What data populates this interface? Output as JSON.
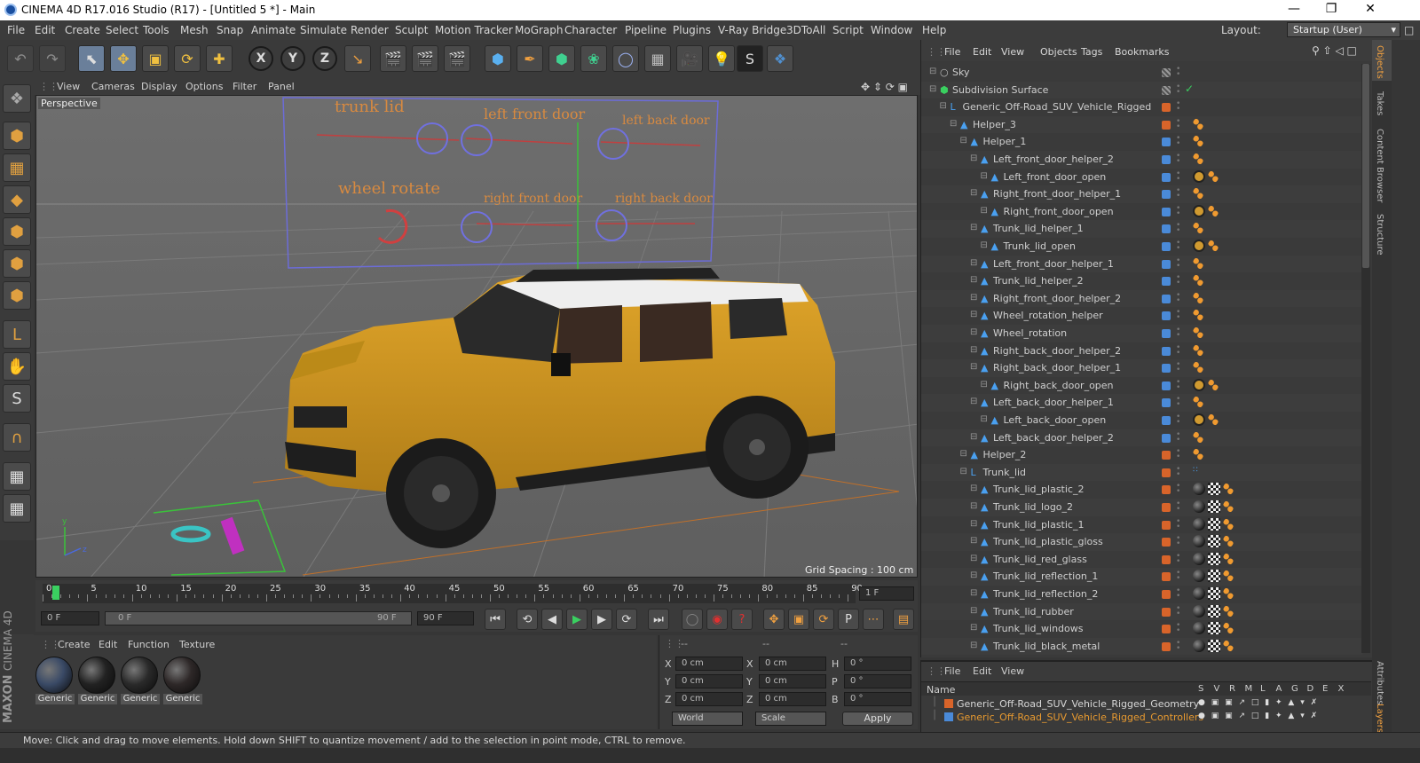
{
  "window": {
    "title": "CINEMA 4D R17.016 Studio (R17) - [Untitled 5 *] - Main"
  },
  "menubar": {
    "items": [
      "File",
      "Edit",
      "Create",
      "Select",
      "Tools",
      "Mesh",
      "Snap",
      "Animate",
      "Simulate",
      "Render",
      "Sculpt",
      "Motion Tracker",
      "MoGraph",
      "Character",
      "Pipeline",
      "Plugins",
      "V-Ray Bridge",
      "3DToAll",
      "Script",
      "Window",
      "Help"
    ],
    "layout_label": "Layout:",
    "layout_value": "Startup (User)"
  },
  "viewport": {
    "menu": [
      "View",
      "Cameras",
      "Display",
      "Options",
      "Filter",
      "Panel"
    ],
    "camera_label": "Perspective",
    "grid_spacing": "Grid Spacing : 100 cm",
    "controller_labels": {
      "trunk_lid": "trunk lid",
      "left_front_door": "left front door",
      "left_back_door": "left back door",
      "wheel_rotate": "wheel rotate",
      "right_front_door": "right front door",
      "right_back_door": "right back door"
    },
    "axis_labels": {
      "y": "y",
      "z": "z"
    }
  },
  "timeline": {
    "ticks": [
      "0",
      "5",
      "10",
      "15",
      "20",
      "25",
      "30",
      "35",
      "40",
      "45",
      "50",
      "55",
      "60",
      "65",
      "70",
      "75",
      "80",
      "85",
      "90"
    ],
    "current_frame_field": "1 F"
  },
  "transport": {
    "start_field": "0 F",
    "range_start": "0 F",
    "range_end": "90 F",
    "end_field": "90 F"
  },
  "materials": {
    "menu": [
      "Create",
      "Edit",
      "Function",
      "Texture"
    ],
    "items": [
      {
        "label": "Generic",
        "color": "#3a4a66"
      },
      {
        "label": "Generic",
        "color": "#222222"
      },
      {
        "label": "Generic",
        "color": "#2a2a2a"
      },
      {
        "label": "Generic",
        "color": "#2e2828"
      }
    ]
  },
  "coordinates": {
    "headers": [
      "--",
      "--",
      "--"
    ],
    "rows": [
      {
        "a": "X",
        "av": "0 cm",
        "b": "X",
        "bv": "0 cm",
        "c": "H",
        "cv": "0 °"
      },
      {
        "a": "Y",
        "av": "0 cm",
        "b": "Y",
        "bv": "0 cm",
        "c": "P",
        "cv": "0 °"
      },
      {
        "a": "Z",
        "av": "0 cm",
        "b": "Z",
        "bv": "0 cm",
        "c": "B",
        "cv": "0 °"
      }
    ],
    "mode_world": "World",
    "mode_scale": "Scale",
    "apply_label": "Apply"
  },
  "brand": {
    "maxon": "MAXON",
    "cinema": "CINEMA 4D"
  },
  "status": {
    "text": "Move: Click and drag to move elements. Hold down SHIFT to quantize movement / add to the selection in point mode, CTRL to remove."
  },
  "object_manager": {
    "menu": [
      "File",
      "Edit",
      "View",
      "Objects",
      "Tags",
      "Bookmarks"
    ],
    "rows": [
      {
        "name": "Sky",
        "indent": 0,
        "icon": "sky",
        "swatch": "",
        "tags": []
      },
      {
        "name": "Subdivision Surface",
        "indent": 0,
        "icon": "subdiv",
        "swatch": "",
        "tags": []
      },
      {
        "name": "Generic_Off-Road_SUV_Vehicle_Rigged",
        "indent": 1,
        "icon": "null",
        "swatch": "#d8642a",
        "tags": []
      },
      {
        "name": "Helper_3",
        "indent": 2,
        "icon": "joint",
        "swatch": "#d8642a",
        "tags": [
          "ik"
        ]
      },
      {
        "name": "Helper_1",
        "indent": 3,
        "icon": "joint",
        "swatch": "#4a8ad8",
        "tags": [
          "ik"
        ]
      },
      {
        "name": "Left_front_door_helper_2",
        "indent": 4,
        "icon": "joint",
        "swatch": "#4a8ad8",
        "tags": [
          "ik"
        ]
      },
      {
        "name": "Left_front_door_open",
        "indent": 5,
        "icon": "joint",
        "swatch": "#4a8ad8",
        "tags": [
          "block",
          "ik"
        ]
      },
      {
        "name": "Right_front_door_helper_1",
        "indent": 4,
        "icon": "joint",
        "swatch": "#4a8ad8",
        "tags": [
          "ik"
        ]
      },
      {
        "name": "Right_front_door_open",
        "indent": 5,
        "icon": "joint",
        "swatch": "#4a8ad8",
        "tags": [
          "block",
          "ik"
        ]
      },
      {
        "name": "Trunk_lid_helper_1",
        "indent": 4,
        "icon": "joint",
        "swatch": "#4a8ad8",
        "tags": [
          "ik"
        ]
      },
      {
        "name": "Trunk_lid_open",
        "indent": 5,
        "icon": "joint",
        "swatch": "#4a8ad8",
        "tags": [
          "block",
          "ik"
        ]
      },
      {
        "name": "Left_front_door_helper_1",
        "indent": 4,
        "icon": "joint",
        "swatch": "#4a8ad8",
        "tags": [
          "ik"
        ]
      },
      {
        "name": "Trunk_lid_helper_2",
        "indent": 4,
        "icon": "joint",
        "swatch": "#4a8ad8",
        "tags": [
          "ik"
        ]
      },
      {
        "name": "Right_front_door_helper_2",
        "indent": 4,
        "icon": "joint",
        "swatch": "#4a8ad8",
        "tags": [
          "ik"
        ]
      },
      {
        "name": "Wheel_rotation_helper",
        "indent": 4,
        "icon": "joint",
        "swatch": "#4a8ad8",
        "tags": [
          "ik"
        ]
      },
      {
        "name": "Wheel_rotation",
        "indent": 4,
        "icon": "joint",
        "swatch": "#4a8ad8",
        "tags": [
          "ik"
        ]
      },
      {
        "name": "Right_back_door_helper_2",
        "indent": 4,
        "icon": "joint",
        "swatch": "#4a8ad8",
        "tags": [
          "ik"
        ]
      },
      {
        "name": "Right_back_door_helper_1",
        "indent": 4,
        "icon": "joint",
        "swatch": "#4a8ad8",
        "tags": [
          "ik"
        ]
      },
      {
        "name": "Right_back_door_open",
        "indent": 5,
        "icon": "joint",
        "swatch": "#4a8ad8",
        "tags": [
          "block",
          "ik"
        ]
      },
      {
        "name": "Left_back_door_helper_1",
        "indent": 4,
        "icon": "joint",
        "swatch": "#4a8ad8",
        "tags": [
          "ik"
        ]
      },
      {
        "name": "Left_back_door_open",
        "indent": 5,
        "icon": "joint",
        "swatch": "#4a8ad8",
        "tags": [
          "block",
          "ik"
        ]
      },
      {
        "name": "Left_back_door_helper_2",
        "indent": 4,
        "icon": "joint",
        "swatch": "#4a8ad8",
        "tags": [
          "ik"
        ]
      },
      {
        "name": "Helper_2",
        "indent": 3,
        "icon": "joint",
        "swatch": "#d8642a",
        "tags": [
          "ik"
        ]
      },
      {
        "name": "Trunk_lid",
        "indent": 3,
        "icon": "null",
        "swatch": "#d8642a",
        "tags": [
          "dots"
        ]
      },
      {
        "name": "Trunk_lid_plastic_2",
        "indent": 4,
        "icon": "joint",
        "swatch": "#d8642a",
        "tags": [
          "mat",
          "check",
          "ik"
        ]
      },
      {
        "name": "Trunk_lid_logo_2",
        "indent": 4,
        "icon": "joint",
        "swatch": "#d8642a",
        "tags": [
          "mat",
          "check",
          "ik"
        ]
      },
      {
        "name": "Trunk_lid_plastic_1",
        "indent": 4,
        "icon": "joint",
        "swatch": "#d8642a",
        "tags": [
          "mat",
          "check",
          "ik"
        ]
      },
      {
        "name": "Trunk_lid_plastic_gloss",
        "indent": 4,
        "icon": "joint",
        "swatch": "#d8642a",
        "tags": [
          "mat",
          "check",
          "ik"
        ]
      },
      {
        "name": "Trunk_lid_red_glass",
        "indent": 4,
        "icon": "joint",
        "swatch": "#d8642a",
        "tags": [
          "mat",
          "check",
          "ik"
        ]
      },
      {
        "name": "Trunk_lid_reflection_1",
        "indent": 4,
        "icon": "joint",
        "swatch": "#d8642a",
        "tags": [
          "mat",
          "check",
          "ik"
        ]
      },
      {
        "name": "Trunk_lid_reflection_2",
        "indent": 4,
        "icon": "joint",
        "swatch": "#d8642a",
        "tags": [
          "mat",
          "check",
          "ik"
        ]
      },
      {
        "name": "Trunk_lid_rubber",
        "indent": 4,
        "icon": "joint",
        "swatch": "#d8642a",
        "tags": [
          "mat",
          "check",
          "ik"
        ]
      },
      {
        "name": "Trunk_lid_windows",
        "indent": 4,
        "icon": "joint",
        "swatch": "#d8642a",
        "tags": [
          "mat",
          "check",
          "ik"
        ]
      },
      {
        "name": "Trunk_lid_black_metal",
        "indent": 4,
        "icon": "joint",
        "swatch": "#d8642a",
        "tags": [
          "mat",
          "check",
          "ik"
        ]
      }
    ]
  },
  "layer_manager": {
    "menu": [
      "File",
      "Edit",
      "View"
    ],
    "columns_name": "Name",
    "columns": [
      "S",
      "V",
      "R",
      "M",
      "L",
      "A",
      "G",
      "D",
      "E",
      "X"
    ],
    "layers": [
      {
        "name": "Generic_Off-Road_SUV_Vehicle_Rigged_Geometry",
        "color": "#d8642a",
        "text_color": "#d8d8d8"
      },
      {
        "name": "Generic_Off-Road_SUV_Vehicle_Rigged_Controllers",
        "color": "#4a8ad8",
        "text_color": "#e89a30"
      }
    ]
  },
  "side_tabs": [
    "Objects",
    "Takes",
    "Content Browser",
    "Structure",
    "Attributes",
    "Layers"
  ]
}
